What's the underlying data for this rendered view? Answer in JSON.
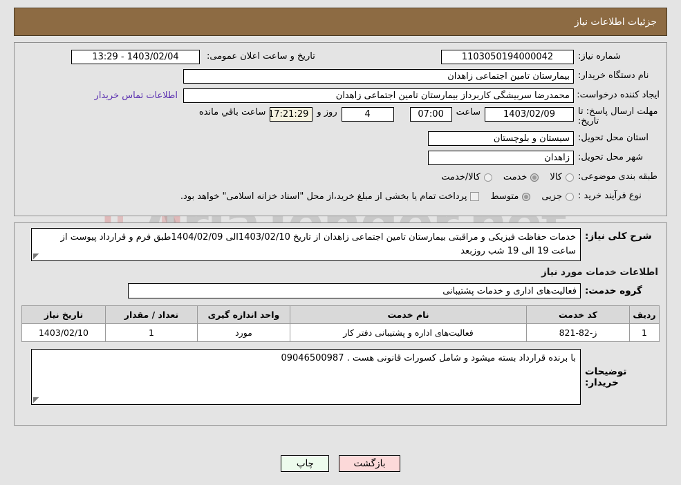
{
  "header": {
    "title": "جزئیات اطلاعات نیاز"
  },
  "colors": {
    "header_bg": "#8d6b43",
    "page_bg": "#e4e4e4",
    "link": "#5a2fb0",
    "print_btn": "#edfbed",
    "back_btn": "#fcd9d9",
    "countdown_bg": "#f5f2e0"
  },
  "watermark": {
    "text": "AriaTender.net"
  },
  "top_section": {
    "need_number": {
      "label": "شماره نیاز:",
      "value": "1103050194000042"
    },
    "announce_datetime": {
      "label": "تاریخ و ساعت اعلان عمومی:",
      "value": "1403/02/04 - 13:29"
    },
    "buyer_org": {
      "label": "نام دستگاه خریدار:",
      "value": "بیمارستان تامین اجتماعی زاهدان"
    },
    "request_creator": {
      "label": "ایجاد کننده درخواست:",
      "value": "محمدرضا سربیشگی کاربرداز بیمارستان تامین اجتماعی زاهدان"
    },
    "buyer_contact_link": "اطلاعات تماس خریدار",
    "deadline": {
      "label_line1": "مهلت ارسال پاسخ: تا",
      "label_line2": "تاریخ:",
      "date": "1403/02/09",
      "time_label": "ساعت",
      "time": "07:00",
      "days": "4",
      "days_label": "روز و",
      "countdown": "17:21:29",
      "remaining_label": "ساعت باقي مانده"
    },
    "delivery_province": {
      "label": "استان محل تحویل:",
      "value": "سیستان و بلوچستان"
    },
    "delivery_city": {
      "label": "شهر محل تحویل:",
      "value": "زاهدان"
    },
    "category": {
      "label": "طبقه بندی موضوعی:",
      "options": [
        {
          "label": "کالا",
          "selected": false
        },
        {
          "label": "خدمت",
          "selected": true
        },
        {
          "label": "کالا/خدمت",
          "selected": false
        }
      ]
    },
    "purchase_process": {
      "label": "نوع فرآیند خرید :",
      "options": [
        {
          "label": "جزیی",
          "selected": false
        },
        {
          "label": "متوسط",
          "selected": true
        }
      ],
      "treasury_note": "پرداخت تمام یا بخشی از مبلغ خرید،از محل \"اسناد خزانه اسلامی\" خواهد بود.",
      "treasury_checked": false
    }
  },
  "description": {
    "label": "شرح کلی نیاز:",
    "text": "خدمات حفاظت فیزیکی  و مراقبتی بیمارستان تامین اجتماعی زاهدان  از تاریخ 1403/02/10الی 1404/02/09طبق فرم و قرارداد پیوست از ساعت 19 الی 19 شب  روزبعد"
  },
  "services_section": {
    "heading": "اطلاعات خدمات مورد نیاز",
    "service_group": {
      "label": "گروه خدمت:",
      "value": "فعالیت‌های اداری و خدمات پشتیبانی"
    },
    "table": {
      "columns": [
        "ردیف",
        "کد خدمت",
        "نام خدمت",
        "واحد اندازه گیری",
        "تعداد / مقدار",
        "تاریخ نیاز"
      ],
      "rows": [
        {
          "row_no": "1",
          "service_code": "ز-82-821",
          "service_name": "فعالیت‌های اداره و پشتیبانی دفتر کار",
          "unit": "مورد",
          "quantity": "1",
          "need_date": "1403/02/10"
        }
      ]
    }
  },
  "buyer_notes": {
    "label": "توضیحات خریدار:",
    "text": "با برنده قرارداد بسته میشود  و شامل کسورات قانونی هست . 09046500987"
  },
  "footer": {
    "print_label": "چاپ",
    "back_label": "بازگشت"
  }
}
